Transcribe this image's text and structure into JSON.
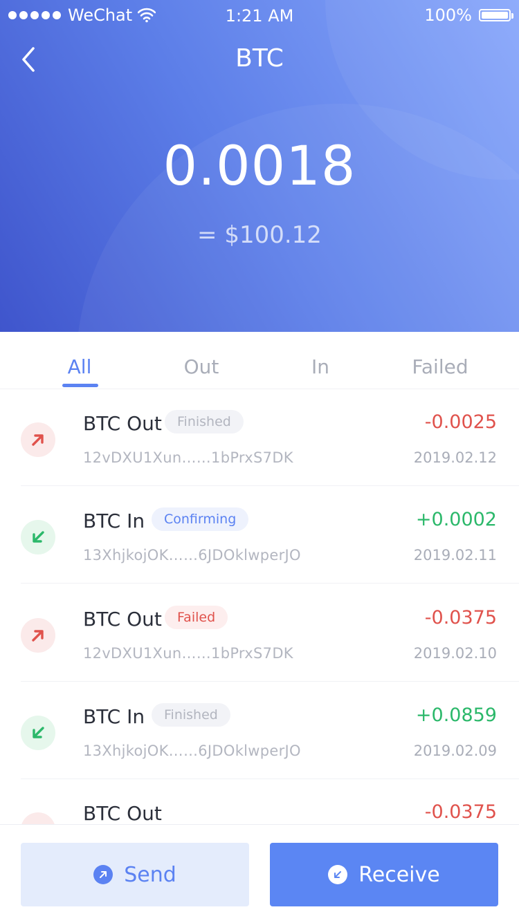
{
  "status_bar": {
    "carrier": "WeChat",
    "time": "1:21 AM",
    "battery": "100%"
  },
  "nav": {
    "title": "BTC"
  },
  "wallet": {
    "balance": "0.0018",
    "fiat_value": "= $100.12"
  },
  "tabs": [
    {
      "label": "All",
      "active": true
    },
    {
      "label": "Out",
      "active": false
    },
    {
      "label": "In",
      "active": false
    },
    {
      "label": "Failed",
      "active": false
    }
  ],
  "transactions": [
    {
      "title": "BTC Out",
      "direction": "out",
      "status": "Finished",
      "address": "12vDXU1Xun……1bPrxS7DK",
      "amount": "-0.0025",
      "date": "2019.02.12"
    },
    {
      "title": "BTC In",
      "direction": "in",
      "status": "Confirming",
      "address": "13XhjkojOK……6JDOklwperJO",
      "amount": "+0.0002",
      "date": "2019.02.11"
    },
    {
      "title": "BTC Out",
      "direction": "out",
      "status": "Failed",
      "address": "12vDXU1Xun……1bPrxS7DK",
      "amount": "-0.0375",
      "date": "2019.02.10"
    },
    {
      "title": "BTC In",
      "direction": "in",
      "status": "Finished",
      "address": "13XhjkojOK……6JDOklwperJO",
      "amount": "+0.0859",
      "date": "2019.02.09"
    },
    {
      "title": "BTC Out",
      "direction": "out",
      "status": "",
      "address": "",
      "amount": "-0.0375",
      "date": ""
    }
  ],
  "actions": {
    "send_label": "Send",
    "receive_label": "Receive"
  },
  "colors": {
    "accent": "#5b82f2",
    "negative": "#e0524c",
    "positive": "#2bb86a"
  }
}
